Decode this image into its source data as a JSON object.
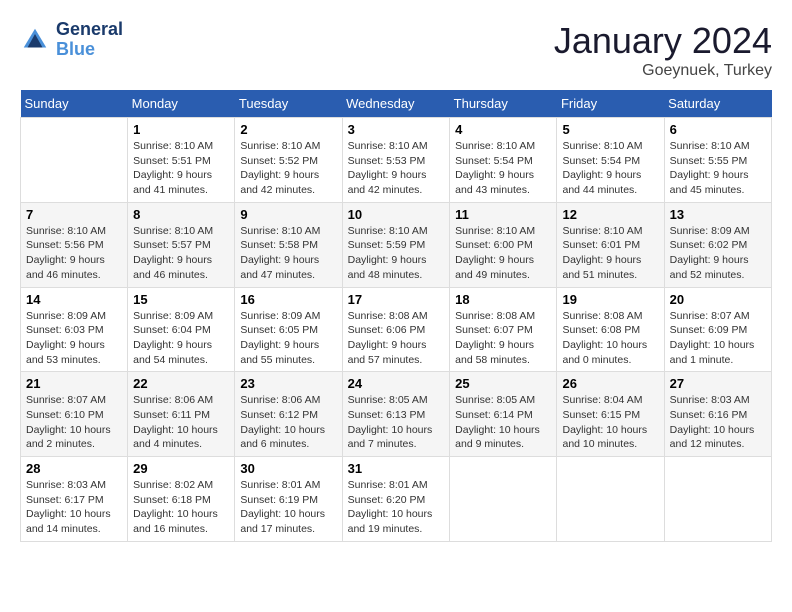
{
  "logo": {
    "line1": "General",
    "line2": "Blue"
  },
  "title": "January 2024",
  "location": "Goeynuek, Turkey",
  "header": {
    "days": [
      "Sunday",
      "Monday",
      "Tuesday",
      "Wednesday",
      "Thursday",
      "Friday",
      "Saturday"
    ]
  },
  "weeks": [
    [
      {
        "day": "",
        "sunrise": "",
        "sunset": "",
        "daylight": ""
      },
      {
        "day": "1",
        "sunrise": "Sunrise: 8:10 AM",
        "sunset": "Sunset: 5:51 PM",
        "daylight": "Daylight: 9 hours and 41 minutes."
      },
      {
        "day": "2",
        "sunrise": "Sunrise: 8:10 AM",
        "sunset": "Sunset: 5:52 PM",
        "daylight": "Daylight: 9 hours and 42 minutes."
      },
      {
        "day": "3",
        "sunrise": "Sunrise: 8:10 AM",
        "sunset": "Sunset: 5:53 PM",
        "daylight": "Daylight: 9 hours and 42 minutes."
      },
      {
        "day": "4",
        "sunrise": "Sunrise: 8:10 AM",
        "sunset": "Sunset: 5:54 PM",
        "daylight": "Daylight: 9 hours and 43 minutes."
      },
      {
        "day": "5",
        "sunrise": "Sunrise: 8:10 AM",
        "sunset": "Sunset: 5:54 PM",
        "daylight": "Daylight: 9 hours and 44 minutes."
      },
      {
        "day": "6",
        "sunrise": "Sunrise: 8:10 AM",
        "sunset": "Sunset: 5:55 PM",
        "daylight": "Daylight: 9 hours and 45 minutes."
      }
    ],
    [
      {
        "day": "7",
        "sunrise": "Sunrise: 8:10 AM",
        "sunset": "Sunset: 5:56 PM",
        "daylight": "Daylight: 9 hours and 46 minutes."
      },
      {
        "day": "8",
        "sunrise": "Sunrise: 8:10 AM",
        "sunset": "Sunset: 5:57 PM",
        "daylight": "Daylight: 9 hours and 46 minutes."
      },
      {
        "day": "9",
        "sunrise": "Sunrise: 8:10 AM",
        "sunset": "Sunset: 5:58 PM",
        "daylight": "Daylight: 9 hours and 47 minutes."
      },
      {
        "day": "10",
        "sunrise": "Sunrise: 8:10 AM",
        "sunset": "Sunset: 5:59 PM",
        "daylight": "Daylight: 9 hours and 48 minutes."
      },
      {
        "day": "11",
        "sunrise": "Sunrise: 8:10 AM",
        "sunset": "Sunset: 6:00 PM",
        "daylight": "Daylight: 9 hours and 49 minutes."
      },
      {
        "day": "12",
        "sunrise": "Sunrise: 8:10 AM",
        "sunset": "Sunset: 6:01 PM",
        "daylight": "Daylight: 9 hours and 51 minutes."
      },
      {
        "day": "13",
        "sunrise": "Sunrise: 8:09 AM",
        "sunset": "Sunset: 6:02 PM",
        "daylight": "Daylight: 9 hours and 52 minutes."
      }
    ],
    [
      {
        "day": "14",
        "sunrise": "Sunrise: 8:09 AM",
        "sunset": "Sunset: 6:03 PM",
        "daylight": "Daylight: 9 hours and 53 minutes."
      },
      {
        "day": "15",
        "sunrise": "Sunrise: 8:09 AM",
        "sunset": "Sunset: 6:04 PM",
        "daylight": "Daylight: 9 hours and 54 minutes."
      },
      {
        "day": "16",
        "sunrise": "Sunrise: 8:09 AM",
        "sunset": "Sunset: 6:05 PM",
        "daylight": "Daylight: 9 hours and 55 minutes."
      },
      {
        "day": "17",
        "sunrise": "Sunrise: 8:08 AM",
        "sunset": "Sunset: 6:06 PM",
        "daylight": "Daylight: 9 hours and 57 minutes."
      },
      {
        "day": "18",
        "sunrise": "Sunrise: 8:08 AM",
        "sunset": "Sunset: 6:07 PM",
        "daylight": "Daylight: 9 hours and 58 minutes."
      },
      {
        "day": "19",
        "sunrise": "Sunrise: 8:08 AM",
        "sunset": "Sunset: 6:08 PM",
        "daylight": "Daylight: 10 hours and 0 minutes."
      },
      {
        "day": "20",
        "sunrise": "Sunrise: 8:07 AM",
        "sunset": "Sunset: 6:09 PM",
        "daylight": "Daylight: 10 hours and 1 minute."
      }
    ],
    [
      {
        "day": "21",
        "sunrise": "Sunrise: 8:07 AM",
        "sunset": "Sunset: 6:10 PM",
        "daylight": "Daylight: 10 hours and 2 minutes."
      },
      {
        "day": "22",
        "sunrise": "Sunrise: 8:06 AM",
        "sunset": "Sunset: 6:11 PM",
        "daylight": "Daylight: 10 hours and 4 minutes."
      },
      {
        "day": "23",
        "sunrise": "Sunrise: 8:06 AM",
        "sunset": "Sunset: 6:12 PM",
        "daylight": "Daylight: 10 hours and 6 minutes."
      },
      {
        "day": "24",
        "sunrise": "Sunrise: 8:05 AM",
        "sunset": "Sunset: 6:13 PM",
        "daylight": "Daylight: 10 hours and 7 minutes."
      },
      {
        "day": "25",
        "sunrise": "Sunrise: 8:05 AM",
        "sunset": "Sunset: 6:14 PM",
        "daylight": "Daylight: 10 hours and 9 minutes."
      },
      {
        "day": "26",
        "sunrise": "Sunrise: 8:04 AM",
        "sunset": "Sunset: 6:15 PM",
        "daylight": "Daylight: 10 hours and 10 minutes."
      },
      {
        "day": "27",
        "sunrise": "Sunrise: 8:03 AM",
        "sunset": "Sunset: 6:16 PM",
        "daylight": "Daylight: 10 hours and 12 minutes."
      }
    ],
    [
      {
        "day": "28",
        "sunrise": "Sunrise: 8:03 AM",
        "sunset": "Sunset: 6:17 PM",
        "daylight": "Daylight: 10 hours and 14 minutes."
      },
      {
        "day": "29",
        "sunrise": "Sunrise: 8:02 AM",
        "sunset": "Sunset: 6:18 PM",
        "daylight": "Daylight: 10 hours and 16 minutes."
      },
      {
        "day": "30",
        "sunrise": "Sunrise: 8:01 AM",
        "sunset": "Sunset: 6:19 PM",
        "daylight": "Daylight: 10 hours and 17 minutes."
      },
      {
        "day": "31",
        "sunrise": "Sunrise: 8:01 AM",
        "sunset": "Sunset: 6:20 PM",
        "daylight": "Daylight: 10 hours and 19 minutes."
      },
      {
        "day": "",
        "sunrise": "",
        "sunset": "",
        "daylight": ""
      },
      {
        "day": "",
        "sunrise": "",
        "sunset": "",
        "daylight": ""
      },
      {
        "day": "",
        "sunrise": "",
        "sunset": "",
        "daylight": ""
      }
    ]
  ]
}
